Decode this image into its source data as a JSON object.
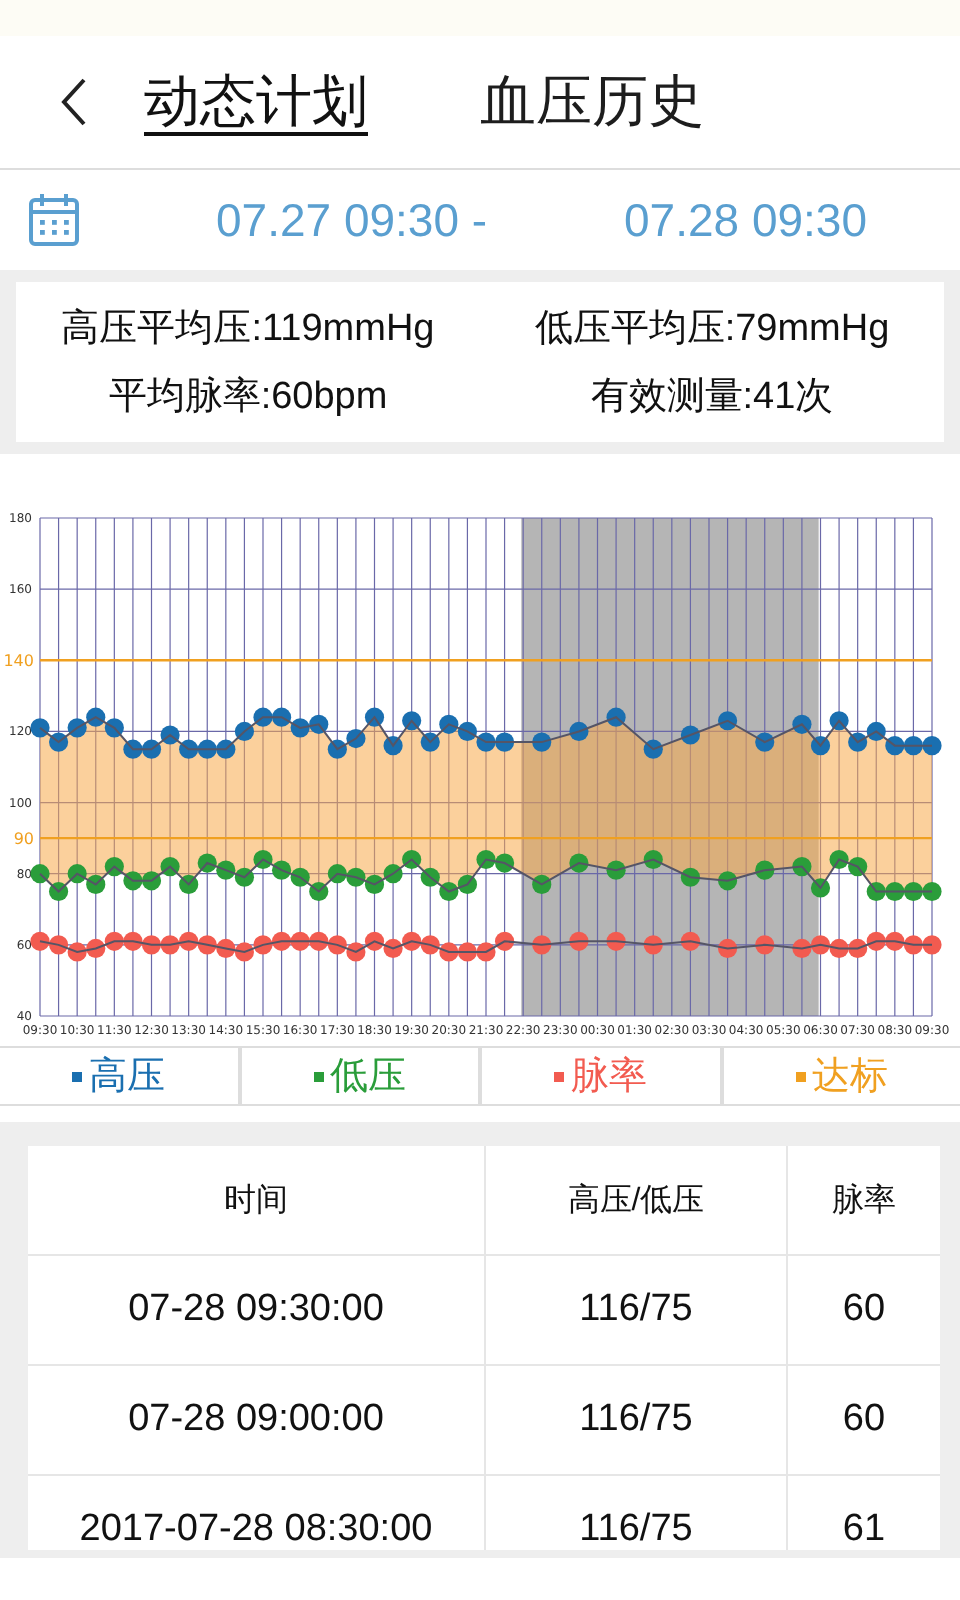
{
  "header": {
    "tabs": [
      {
        "label": "动态计划",
        "selected": true
      },
      {
        "label": "血压历史",
        "selected": false
      }
    ]
  },
  "date_range": {
    "start": "07.27 09:30 -",
    "end": "07.28 09:30"
  },
  "stats": [
    "高压平均压:119mmHg",
    "低压平均压:79mmHg",
    "平均脉率:60bpm",
    "有效测量:41次"
  ],
  "chart": {
    "chart_data": {
      "type": "line",
      "ylim": [
        40,
        180
      ],
      "categories": [
        "09:30",
        null,
        "10:30",
        null,
        "11:30",
        null,
        "12:30",
        null,
        "13:30",
        null,
        "14:30",
        null,
        "15:30",
        null,
        "16:30",
        null,
        "17:30",
        null,
        "18:30",
        null,
        "19:30",
        null,
        "20:30",
        null,
        "21:30",
        null,
        "22:30",
        null,
        "23:30",
        null,
        "00:30",
        null,
        "01:30",
        null,
        "02:30",
        null,
        "03:30",
        null,
        "04:30",
        null,
        "05:30",
        null,
        "06:30",
        null,
        "07:30",
        null,
        "08:30",
        null,
        "09:30"
      ],
      "series": [
        {
          "name": "高压",
          "color": "#1a6fb0",
          "marker": "o",
          "values": [
            121,
            117,
            121,
            124,
            121,
            115,
            115,
            119,
            115,
            115,
            115,
            120,
            124,
            124,
            121,
            122,
            115,
            118,
            124,
            116,
            123,
            117,
            122,
            120,
            117,
            117,
            null,
            117,
            null,
            120,
            null,
            124,
            null,
            115,
            null,
            119,
            null,
            123,
            null,
            117,
            null,
            122,
            116,
            123,
            117,
            120,
            116,
            116,
            116
          ]
        },
        {
          "name": "低压",
          "color": "#2a9d3a",
          "marker": "o",
          "values": [
            80,
            75,
            80,
            77,
            82,
            78,
            78,
            82,
            77,
            83,
            81,
            79,
            84,
            81,
            79,
            75,
            80,
            79,
            77,
            80,
            84,
            79,
            75,
            77,
            84,
            83,
            null,
            77,
            null,
            83,
            null,
            81,
            null,
            84,
            null,
            79,
            null,
            78,
            null,
            81,
            null,
            82,
            76,
            84,
            82,
            75,
            75,
            75,
            75
          ]
        },
        {
          "name": "脉率",
          "color": "#f25b50",
          "marker": "o",
          "values": [
            61,
            60,
            58,
            59,
            61,
            61,
            60,
            60,
            61,
            60,
            59,
            58,
            60,
            61,
            61,
            61,
            60,
            58,
            61,
            59,
            61,
            60,
            58,
            58,
            58,
            61,
            null,
            60,
            null,
            61,
            null,
            61,
            null,
            60,
            null,
            61,
            null,
            59,
            null,
            60,
            null,
            59,
            60,
            59,
            59,
            61,
            61,
            60,
            60
          ]
        }
      ],
      "yticks": [
        40,
        60,
        80,
        100,
        120,
        160,
        180
      ],
      "grid": true,
      "ref_lines": [
        {
          "axis": "y",
          "value": 140,
          "label": "140",
          "color": "#f0a020"
        },
        {
          "axis": "y",
          "value": 90,
          "label": "90",
          "color": "#f0a020"
        }
      ]
    }
  },
  "legend": [
    {
      "label": "达标",
      "color": "#f0a020"
    }
  ],
  "table": {
    "columns": [
      "时间",
      "高压/低压",
      "脉率"
    ],
    "rows": [
      [
        "07-28 09:30:00",
        "116/75",
        "60"
      ],
      [
        "07-28 09:00:00",
        "116/75",
        "60"
      ],
      [
        "2017-07-28 08:30:00",
        "116/75",
        "61"
      ]
    ]
  }
}
